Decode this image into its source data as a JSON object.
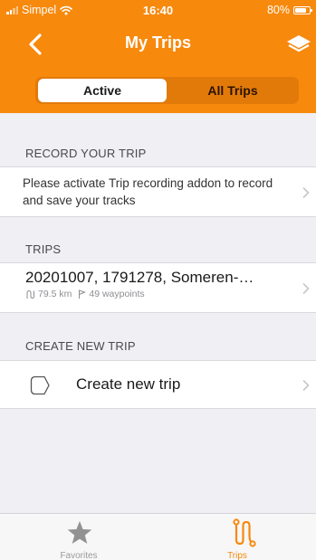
{
  "status_bar": {
    "carrier": "Simpel",
    "time": "16:40",
    "battery": "80%",
    "battery_level": 0.8
  },
  "header": {
    "title": "My Trips"
  },
  "segments": {
    "active": "Active",
    "all": "All Trips",
    "selected": "Active"
  },
  "record": {
    "header": "RECORD YOUR TRIP",
    "text": "Please activate Trip recording addon to record and save your tracks"
  },
  "trips": {
    "header": "TRIPS",
    "items": [
      {
        "title": "20201007, 1791278, Someren-…",
        "distance": "79.5 km",
        "waypoints": "49 waypoints"
      }
    ]
  },
  "create": {
    "header": "CREATE NEW TRIP",
    "label": "Create new trip"
  },
  "tabbar": {
    "favorites": "Favorites",
    "trips": "Trips",
    "active": "Trips"
  },
  "colors": {
    "accent": "#f7890d",
    "segment_bg": "#e27a0a",
    "inactive_tab": "#9a9a9a"
  },
  "icons": [
    "chevron-left-icon",
    "layers-icon",
    "chevron-right-icon",
    "route-icon",
    "waypoint-flag-icon",
    "shape-outline-icon",
    "star-icon",
    "trips-route-icon"
  ]
}
